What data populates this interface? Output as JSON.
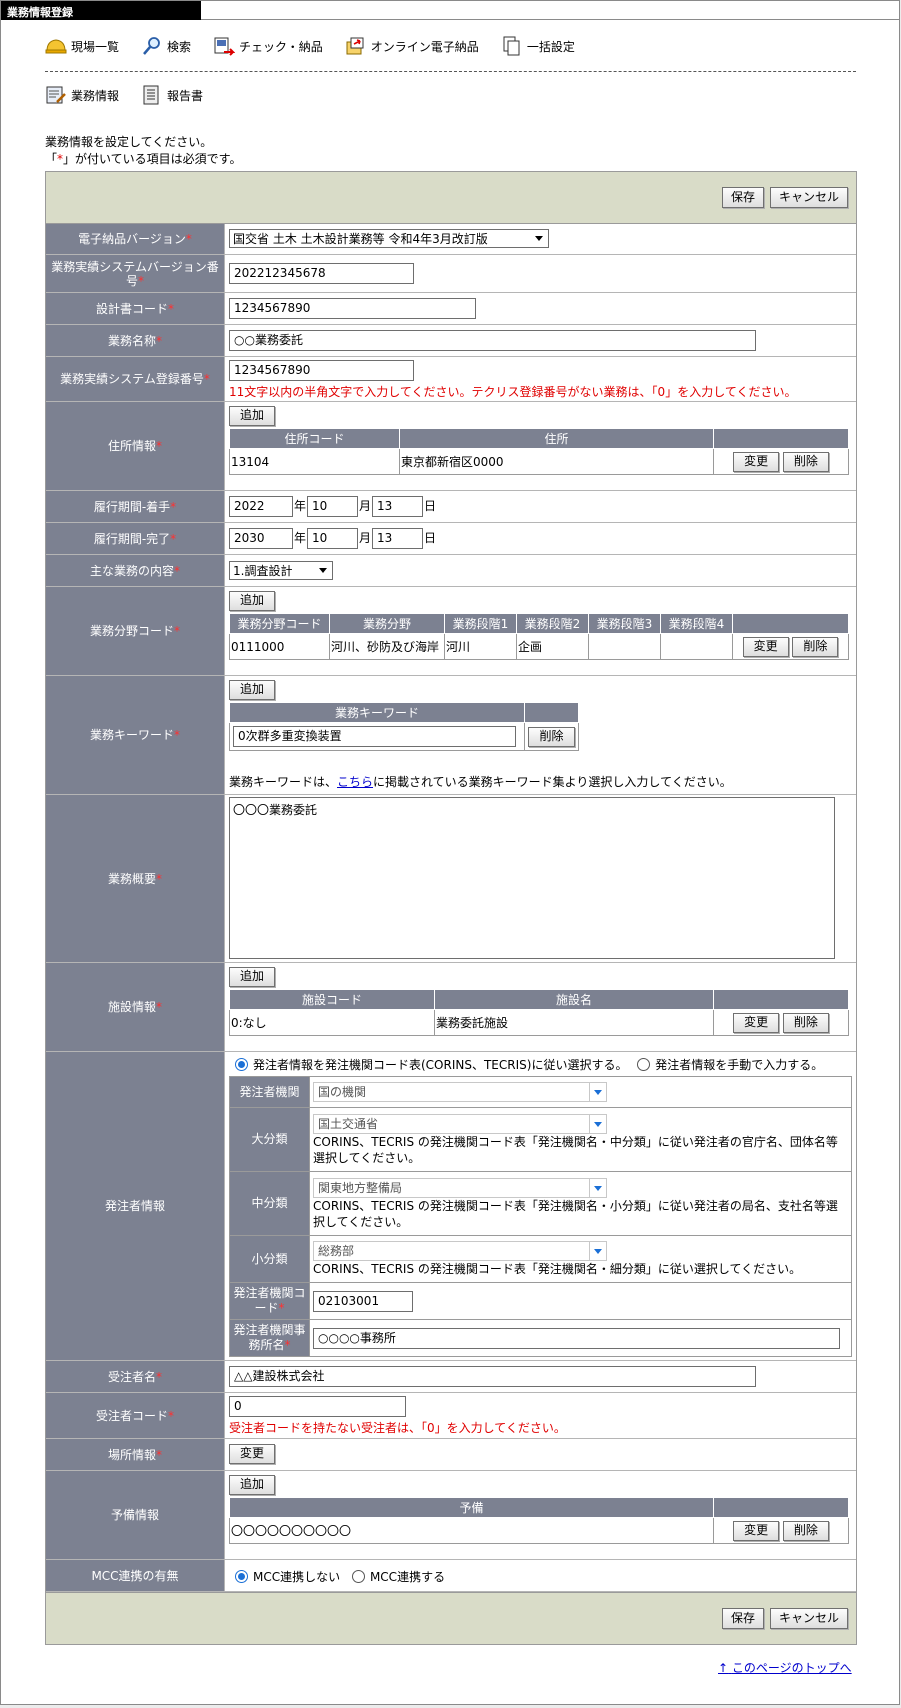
{
  "window_title": "業務情報登録",
  "nav1": [
    {
      "label": "現場一覧",
      "icon": "helmet-icon"
    },
    {
      "label": "検索",
      "icon": "magnifier-icon"
    },
    {
      "label": "チェック・納品",
      "icon": "check-deliver-icon"
    },
    {
      "label": "オンライン電子納品",
      "icon": "online-deliver-icon"
    },
    {
      "label": "一括設定",
      "icon": "copy-icon"
    }
  ],
  "nav2": [
    {
      "label": "業務情報",
      "icon": "edit-document-icon"
    },
    {
      "label": "報告書",
      "icon": "report-icon"
    }
  ],
  "intro": {
    "line1": "業務情報を設定してください。",
    "line2_pre": "「",
    "line2_star": "*",
    "line2_post": "」が付いている項目は必須です。"
  },
  "buttons": {
    "save": "保存",
    "cancel": "キャンセル",
    "add": "追加",
    "edit": "変更",
    "delete": "削除"
  },
  "req_mark": "*",
  "fields": {
    "version": {
      "label": "電子納品バージョン",
      "value": "国交省 土木 土木設計業務等 令和4年3月改訂版"
    },
    "sys_version": {
      "label": "業務実績システムバージョン番号",
      "value": "202212345678"
    },
    "design_code": {
      "label": "設計書コード",
      "value": "1234567890"
    },
    "work_name": {
      "label": "業務名称",
      "value": "○○業務委託"
    },
    "sys_reg": {
      "label": "業務実績システム登録番号",
      "value": "1234567890",
      "note": "11文字以内の半角文字で入力してください。テクリス登録番号がない業務は、「0」を入力してください。"
    },
    "address": {
      "label": "住所情報",
      "col1": "住所コード",
      "col2": "住所",
      "rows": [
        {
          "code": "13104",
          "addr": "東京都新宿区0000"
        }
      ]
    },
    "start": {
      "label": "履行期間-着手",
      "y": "2022",
      "m": "10",
      "d": "13"
    },
    "end": {
      "label": "履行期間-完了",
      "y": "2030",
      "m": "10",
      "d": "13"
    },
    "date_units": {
      "y": "年",
      "m": "月",
      "d": "日"
    },
    "main_content": {
      "label": "主な業務の内容",
      "value": "1.調査設計"
    },
    "field_code": {
      "label": "業務分野コード",
      "cols": [
        "業務分野コード",
        "業務分野",
        "業務段階1",
        "業務段階2",
        "業務段階3",
        "業務段階4"
      ],
      "rows": [
        [
          "0111000",
          "河川、砂防及び海岸",
          "河川",
          "企画",
          "",
          ""
        ]
      ]
    },
    "keyword": {
      "label": "業務キーワード",
      "col": "業務キーワード",
      "value": "0次群多重変換装置",
      "note_pre": "業務キーワードは、",
      "note_link": "こちら",
      "note_post": "に掲載されている業務キーワード集より選択し入力してください。"
    },
    "summary": {
      "label": "業務概要",
      "value": "〇〇〇業務委託"
    },
    "facility": {
      "label": "施設情報",
      "col1": "施設コード",
      "col2": "施設名",
      "rows": [
        {
          "code": "0:なし",
          "name": "業務委託施設"
        }
      ]
    },
    "orderer": {
      "label": "発注者情報",
      "radio1": "発注者情報を発注機関コード表(CORINS、TECRIS)に従い選択する。",
      "radio2": "発注者情報を手動で入力する。",
      "org_label": "発注者機関",
      "org_value": "国の機関",
      "l_label": "大分類",
      "l_value": "国土交通省",
      "l_note": "CORINS、TECRIS の発注機関コード表「発注機関名・中分類」に従い発注者の官庁名、団体名等選択してください。",
      "m_label": "中分類",
      "m_value": "関東地方整備局",
      "m_note": "CORINS、TECRIS の発注機関コード表「発注機関名・小分類」に従い発注者の局名、支社名等選択してください。",
      "s_label": "小分類",
      "s_value": "総務部",
      "s_note": "CORINS、TECRIS の発注機関コード表「発注機関名・細分類」に従い選択してください。",
      "code_label": "発注者機関コード",
      "code_value": "02103001",
      "office_label": "発注者機関事務所名",
      "office_value": "○○○○事務所"
    },
    "contractor": {
      "label": "受注者名",
      "value": "△△建設株式会社"
    },
    "contractor_code": {
      "label": "受注者コード",
      "value": "0",
      "note": "受注者コードを持たない受注者は、「0」を入力してください。"
    },
    "location": {
      "label": "場所情報"
    },
    "reserve": {
      "label": "予備情報",
      "col": "予備",
      "rows": [
        {
          "value": "〇〇〇〇〇〇〇〇〇〇"
        }
      ]
    },
    "mcc": {
      "label": "MCC連携の有無",
      "opt1": "MCC連携しない",
      "opt2": "MCC連携する"
    }
  },
  "top_link": "このページのトップへ"
}
